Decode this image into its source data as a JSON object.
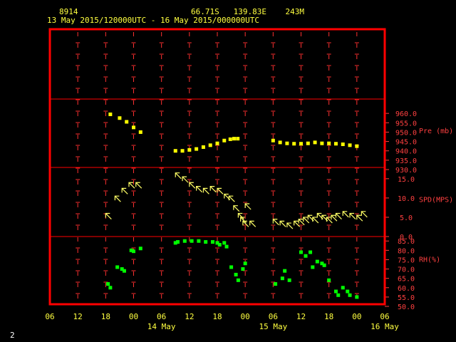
{
  "header": {
    "station": "8914",
    "location": "66.71S   139.83E    243M",
    "time_range": "13 May 2015/120000UTC - 16 May 2015/000000UTC"
  },
  "footer": {
    "frame_number": "2"
  },
  "colors": {
    "frame": "#ff0000",
    "grid": "#ff3030",
    "label": "#ff4040",
    "pressure": "#ffff00",
    "wind": "#ffff66",
    "rh": "#00ff00",
    "time_axis": "#ffff40"
  },
  "chart_data": {
    "type": "scatter",
    "x_unit": "hours since 13 May 2015 06 UTC",
    "x_tick_labels": [
      "06",
      "12",
      "18",
      "00",
      "06",
      "12",
      "18",
      "00",
      "06",
      "12",
      "18",
      "00",
      "06"
    ],
    "day_labels": [
      "14 May",
      "15 May",
      "16 May"
    ],
    "xlim": [
      0,
      72
    ],
    "panels": [
      {
        "name": "pressure",
        "label": "Pre (mb)",
        "ylim": [
          930,
          965
        ],
        "y_ticks": [
          "960.0",
          "955.0",
          "950.0",
          "945.0",
          "940.0",
          "935.0",
          "930.0"
        ],
        "series": [
          {
            "values": [
              [
                13,
                959.5
              ],
              [
                15,
                957.5
              ],
              [
                16.5,
                955.5
              ],
              [
                18,
                952.5
              ],
              [
                19.5,
                950
              ],
              [
                27,
                940
              ],
              [
                28.5,
                940
              ],
              [
                30,
                940.5
              ],
              [
                31.5,
                941
              ],
              [
                33,
                942
              ],
              [
                34.5,
                943
              ],
              [
                36,
                944
              ],
              [
                37.5,
                945.5
              ],
              [
                38.8,
                946.2
              ],
              [
                39.6,
                946.5
              ],
              [
                40.4,
                946.5
              ],
              [
                48,
                945.5
              ],
              [
                49.5,
                944.5
              ],
              [
                51,
                944
              ],
              [
                52.5,
                943.8
              ],
              [
                54,
                943.8
              ],
              [
                55.5,
                944
              ],
              [
                57,
                944.5
              ],
              [
                58.5,
                944
              ],
              [
                60,
                944
              ],
              [
                61.5,
                943.8
              ],
              [
                63,
                943.5
              ],
              [
                64.5,
                943
              ],
              [
                66,
                942.5
              ]
            ]
          }
        ]
      },
      {
        "name": "wind",
        "label": "SPD(MPS)",
        "ylim": [
          0,
          17
        ],
        "y_ticks": [
          "15.0",
          "10.0",
          "5.0",
          "0.0"
        ],
        "series": [
          {
            "values": [
              [
                12,
                6
              ],
              [
                14,
                10.5
              ],
              [
                15.5,
                12.5
              ],
              [
                17,
                14
              ],
              [
                18.5,
                14
              ],
              [
                27,
                16.5
              ],
              [
                28.5,
                15.5
              ],
              [
                30,
                14
              ],
              [
                31.5,
                13
              ],
              [
                33,
                12.5
              ],
              [
                34.5,
                13
              ],
              [
                36,
                12.5
              ],
              [
                37.5,
                11
              ],
              [
                38.5,
                10.5
              ],
              [
                39.5,
                8
              ],
              [
                40.5,
                6
              ],
              [
                41,
                5
              ],
              [
                41.5,
                4
              ],
              [
                42,
                8.5
              ],
              [
                43,
                4
              ],
              [
                48,
                4.5
              ],
              [
                49.5,
                4
              ],
              [
                51,
                3.5
              ],
              [
                52.5,
                4
              ],
              [
                53.5,
                4.5
              ],
              [
                54.5,
                5
              ],
              [
                55.5,
                5.5
              ],
              [
                56.5,
                5
              ],
              [
                57.5,
                6
              ],
              [
                58.5,
                5.5
              ],
              [
                59.5,
                5
              ],
              [
                60.5,
                5.5
              ],
              [
                61.5,
                6
              ],
              [
                63,
                6.5
              ],
              [
                64.5,
                6
              ],
              [
                66,
                5.5
              ],
              [
                67,
                6.5
              ]
            ]
          }
        ]
      },
      {
        "name": "rh",
        "label": "RH(%)",
        "ylim": [
          50,
          87
        ],
        "y_ticks": [
          "85.0",
          "80.0",
          "75.0",
          "70.0",
          "65.0",
          "60.0",
          "55.0",
          "50.0"
        ],
        "series": [
          {
            "values": [
              [
                12.5,
                62
              ],
              [
                13,
                60
              ],
              [
                14.5,
                71
              ],
              [
                15.5,
                70
              ],
              [
                16,
                69
              ],
              [
                17.5,
                80
              ],
              [
                18,
                79.5
              ],
              [
                19.5,
                81
              ],
              [
                27,
                84
              ],
              [
                27.5,
                84.5
              ],
              [
                29,
                85
              ],
              [
                30.5,
                85
              ],
              [
                32,
                85
              ],
              [
                33.5,
                84.5
              ],
              [
                35,
                84.5
              ],
              [
                36,
                84
              ],
              [
                36.5,
                83
              ],
              [
                37.5,
                84
              ],
              [
                38,
                82
              ],
              [
                39,
                71
              ],
              [
                40,
                67
              ],
              [
                40.5,
                64
              ],
              [
                41.5,
                70
              ],
              [
                42,
                73
              ],
              [
                48.5,
                62
              ],
              [
                50,
                65
              ],
              [
                50.5,
                69
              ],
              [
                51.5,
                64
              ],
              [
                54,
                79
              ],
              [
                55,
                77
              ],
              [
                56,
                79
              ],
              [
                56.5,
                71
              ],
              [
                57.5,
                74
              ],
              [
                58.5,
                73
              ],
              [
                59,
                72
              ],
              [
                60,
                64
              ],
              [
                61.5,
                58
              ],
              [
                62,
                56
              ],
              [
                63,
                60
              ],
              [
                64,
                58
              ],
              [
                64.5,
                56
              ],
              [
                66,
                55
              ]
            ]
          }
        ]
      }
    ]
  }
}
